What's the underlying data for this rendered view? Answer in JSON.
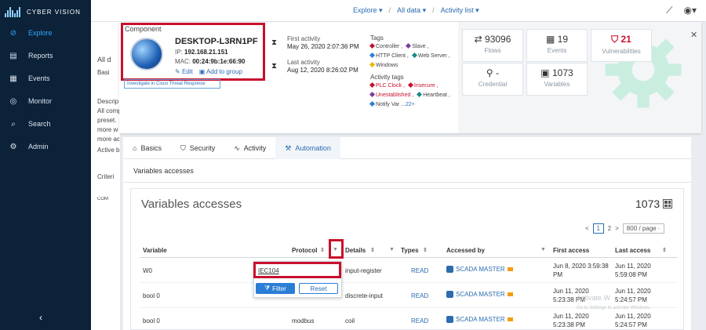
{
  "app": {
    "brand": "CYBER VISION"
  },
  "sidebar": {
    "items": [
      {
        "label": "Explore",
        "icon": "compass-icon",
        "active": true
      },
      {
        "label": "Reports",
        "icon": "report-icon",
        "active": false
      },
      {
        "label": "Events",
        "icon": "calendar-icon",
        "active": false
      },
      {
        "label": "Monitor",
        "icon": "monitor-icon",
        "active": false
      },
      {
        "label": "Search",
        "icon": "search-icon",
        "active": false
      },
      {
        "label": "Admin",
        "icon": "gear-icon",
        "active": false
      }
    ],
    "collapse": "‹"
  },
  "topnav": {
    "explore": "Explore ▾",
    "sep1": "/",
    "alldata": "All data ▾",
    "sep2": "/",
    "activity": "Activity list ▾"
  },
  "background": {
    "frag1": "All d",
    "frag2": "Basi",
    "frag3": "Descrip",
    "frag4": "All comp",
    "frag5": "preset.",
    "frag6": "more w",
    "frag7": "more ac",
    "frag8": "Active b",
    "frag9": "Criteri",
    "frag10": "COM"
  },
  "component": {
    "label": "Component",
    "name": "DESKTOP-L3RN1PF",
    "ip_label": "IP:",
    "ip": "192.168.21.151",
    "mac_label": "MAC:",
    "mac": "00:24:9b:1e:66:90",
    "edit": "Edit",
    "add_group": "Add to group",
    "investigate": "Investigate in Cisco Threat Response"
  },
  "activity": {
    "first_label": "First activity",
    "first_value": "May 26, 2020 2:07:36 PM",
    "last_label": "Last activity",
    "last_value": "Aug 12, 2020 8:26:02 PM"
  },
  "tags": {
    "head": "Tags",
    "items": [
      "Controller ,",
      "Slave ,",
      "HTTP Client ,",
      "Web Server ,",
      "Windows"
    ],
    "activity_head": "Activity tags",
    "activity_items": [
      "PLC Clock ,",
      "Insecure ,",
      "Unestablished ,",
      "Heartbeat ,",
      "Notify Var ..."
    ],
    "more": "22+"
  },
  "stats": {
    "flows_num": "93096",
    "flows_lbl": "Flows",
    "events_num": "19",
    "events_lbl": "Events",
    "vuln_num": "21",
    "vuln_lbl": "Vulnerabilities",
    "cred_num": "-",
    "cred_lbl": "Credential",
    "vars_num": "1073",
    "vars_lbl": "Variables"
  },
  "tabs": [
    {
      "label": "Basics",
      "icon": "home-icon"
    },
    {
      "label": "Security",
      "icon": "shield-icon"
    },
    {
      "label": "Activity",
      "icon": "activity-icon"
    },
    {
      "label": "Automation",
      "icon": "wrench-icon",
      "active": true
    }
  ],
  "subtitle": "Variables accesses",
  "card": {
    "title": "Variables accesses",
    "count": "1073"
  },
  "pager": {
    "prev": "<",
    "p1": "1",
    "p2": "2",
    "next": ">",
    "size": "800 / page ·"
  },
  "table": {
    "headers": [
      "Variable",
      "Protocol",
      "Details",
      "Types",
      "Accessed by",
      "First access",
      "Last access"
    ],
    "rows": [
      {
        "variable": "W0",
        "protocol": "",
        "details": "input-register",
        "type": "READ",
        "accessed_by": "SCADA MASTER",
        "first": [
          "Jun 8, 2020 3:59:38",
          "PM"
        ],
        "last": [
          "Jun 11, 2020",
          "5:59:08 PM"
        ]
      },
      {
        "variable": "bool 0",
        "protocol": "",
        "details": "discrete-input",
        "type": "READ",
        "accessed_by": "SCADA MASTER",
        "first": [
          "Jun 11, 2020",
          "5:23:38 PM"
        ],
        "last": [
          "Jun 11, 2020",
          "5:24:57 PM"
        ]
      },
      {
        "variable": "bool 0",
        "protocol": "modbus",
        "details": "coil",
        "type": "READ",
        "accessed_by": "SCADA MASTER",
        "first": [
          "Jun 11, 2020",
          "5:23:38 PM"
        ],
        "last": [
          "Jun 11, 2020",
          "5:24:57 PM"
        ]
      }
    ]
  },
  "filter": {
    "value": "IEC104",
    "apply": "Filter",
    "reset": "Reset"
  },
  "watermark": {
    "line1": "Activate W",
    "line2": "Go to Settings to activate Windows."
  },
  "colors": {
    "accent": "#2b6cb0",
    "highlight": "#c8102e",
    "sidebar": "#0b2239"
  }
}
